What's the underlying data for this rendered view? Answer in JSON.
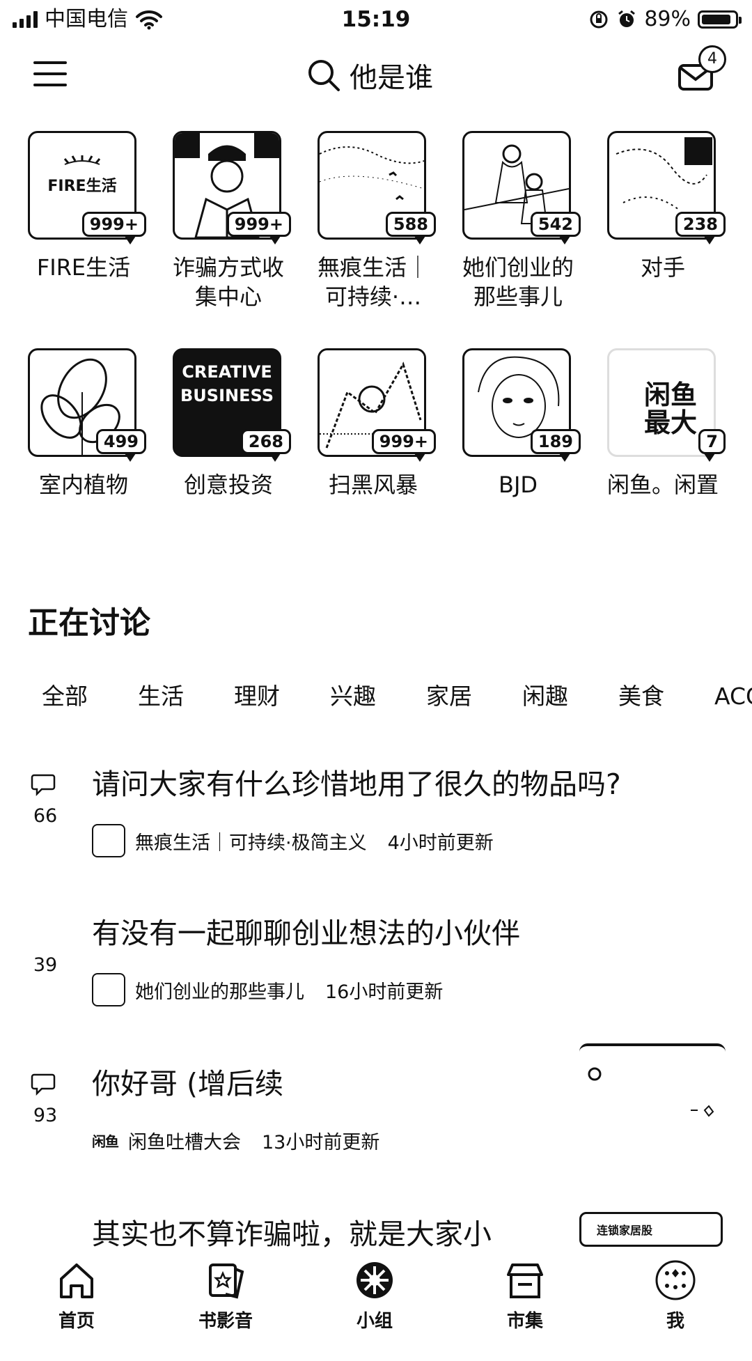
{
  "status_bar": {
    "carrier": "中国电信",
    "time": "15:19",
    "battery": "89%"
  },
  "header": {
    "search_text": "他是谁",
    "mail_badge": "4"
  },
  "groups": [
    {
      "name": "FIRE生活",
      "count": "999+",
      "thumb_text": "FIRE生活"
    },
    {
      "name": "诈骗方式收\n集中心",
      "count": "999+"
    },
    {
      "name": "無痕生活｜\n可持续·…",
      "count": "588"
    },
    {
      "name": "她们创业的\n那些事儿",
      "count": "542"
    },
    {
      "name": "对手",
      "count": "238"
    },
    {
      "name": "室内植物",
      "count": "499"
    },
    {
      "name": "创意投资",
      "count": "268",
      "thumb_text": "CREATIVE\nBUSINESS"
    },
    {
      "name": "扫黑风暴",
      "count": "999+"
    },
    {
      "name": "BJD",
      "count": "189"
    },
    {
      "name": "闲鱼。闲置",
      "count": "7",
      "thumb_text": "闲鱼\n最大"
    }
  ],
  "discussion": {
    "title": "正在讨论",
    "tabs": [
      "全部",
      "生活",
      "理财",
      "兴趣",
      "家居",
      "闲趣",
      "美食",
      "ACG"
    ]
  },
  "posts": [
    {
      "count": "66",
      "title": "请问大家有什么珍惜地用了很久的物品吗?",
      "group": "無痕生活｜可持续·极简主义",
      "time": "4小时前更新"
    },
    {
      "count": "39",
      "title": "有没有一起聊聊创业想法的小伙伴",
      "group": "她们创业的那些事儿",
      "time": "16小时前更新"
    },
    {
      "count": "93",
      "title": "你好哥 (增后续",
      "group": "闲鱼吐槽大会",
      "time": "13小时前更新",
      "avatar_text": "闲鱼"
    },
    {
      "count": "",
      "title": "其实也不算诈骗啦，就是大家小",
      "group": "",
      "time": "",
      "thumb_text": "连锁家居股"
    }
  ],
  "bottom_nav": [
    {
      "label": "首页",
      "icon": "home-icon"
    },
    {
      "label": "书影音",
      "icon": "star-card-icon"
    },
    {
      "label": "小组",
      "icon": "group-icon"
    },
    {
      "label": "市集",
      "icon": "market-icon"
    },
    {
      "label": "我",
      "icon": "profile-icon"
    }
  ]
}
